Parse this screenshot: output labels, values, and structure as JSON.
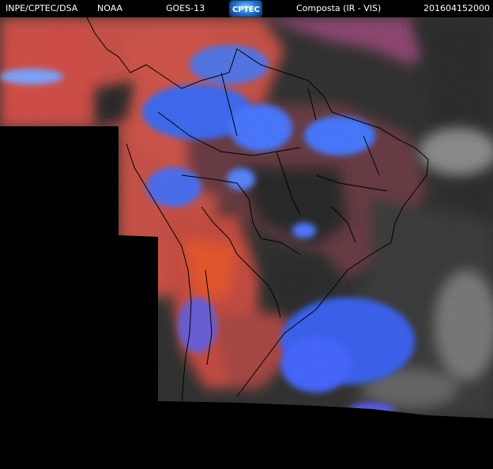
{
  "header": {
    "source": "INPE/CPTEC/DSA",
    "agency": "NOAA",
    "satellite": "GOES-13",
    "logo_text": "CPTEC",
    "product": "Composta (IR - VIS)",
    "timestamp": "201604152000"
  },
  "colors": {
    "background": "#000000",
    "header_text": "#ffffff",
    "warm_surface": "#d9574f",
    "cold_cloud": "#3a6cff",
    "night_gray": "#3a3a3a",
    "coastline": "#000000"
  }
}
